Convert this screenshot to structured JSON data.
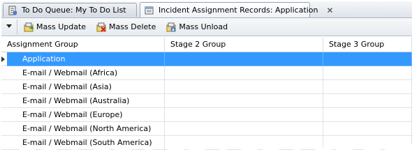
{
  "tabs": [
    {
      "label": "To Do Queue: My To Do List",
      "active": false,
      "icon": "queue-icon"
    },
    {
      "label": "Incident Assignment Records:  Application",
      "active": true,
      "icon": "records-icon",
      "close": "✕"
    }
  ],
  "toolbar": {
    "dropdown_icon": "chevron-down-icon",
    "buttons": [
      {
        "label": "Mass Update",
        "icon": "mass-update-icon"
      },
      {
        "label": "Mass Delete",
        "icon": "mass-delete-icon"
      },
      {
        "label": "Mass Unload",
        "icon": "mass-unload-icon"
      }
    ]
  },
  "grid": {
    "columns": [
      "Assignment Group",
      "Stage 2 Group",
      "Stage 3 Group"
    ],
    "rows": [
      [
        "Application",
        "",
        ""
      ],
      [
        "E-mail / Webmail (Africa)",
        "",
        ""
      ],
      [
        "E-mail / Webmail (Asia)",
        "",
        ""
      ],
      [
        "E-mail / Webmail (Australia)",
        "",
        ""
      ],
      [
        "E-mail / Webmail (Europe)",
        "",
        ""
      ],
      [
        "E-mail / Webmail (North America)",
        "",
        ""
      ],
      [
        "E-mail / Webmail (South America)",
        "",
        ""
      ],
      [
        "Field Support (Africa)",
        "",
        ""
      ]
    ],
    "selected_row": 0
  },
  "colors": {
    "selection": "#3399ff",
    "selection_text": "#ffffff"
  }
}
